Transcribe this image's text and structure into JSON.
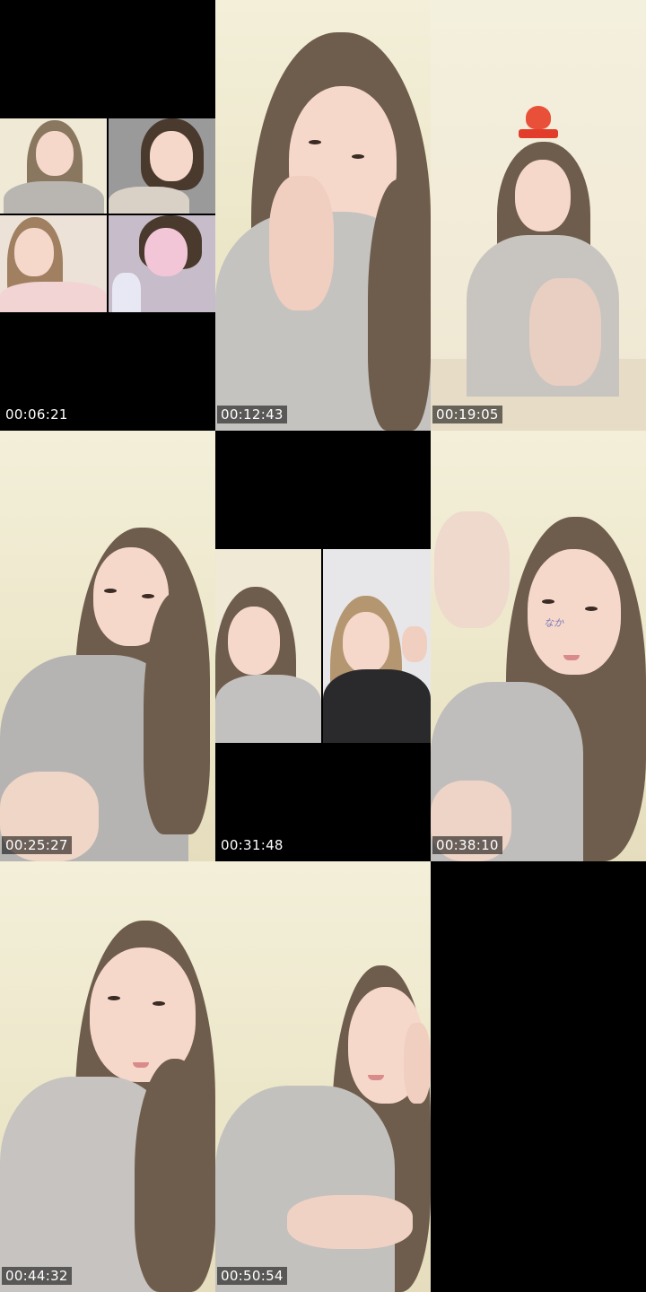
{
  "tiles": [
    {
      "timestamp": "00:06:21",
      "kind": "multi-call"
    },
    {
      "timestamp": "00:12:43",
      "kind": "selfie"
    },
    {
      "timestamp": "00:19:05",
      "kind": "sitting"
    },
    {
      "timestamp": "00:25:27",
      "kind": "crouch"
    },
    {
      "timestamp": "00:31:48",
      "kind": "duo-call"
    },
    {
      "timestamp": "00:38:10",
      "kind": "wave"
    },
    {
      "timestamp": "00:44:32",
      "kind": "selfie"
    },
    {
      "timestamp": "00:50:54",
      "kind": "selfie"
    },
    {
      "timestamp": "",
      "kind": "empty"
    }
  ],
  "colors": {
    "background": "#000000",
    "wall": "#f3efd9",
    "hair": "#6e5d4c",
    "shirt": "#b9b6b2",
    "badge": "#e9503a",
    "doodle": "#7a79b8"
  },
  "icons": {
    "badge": "heart-badge-icon"
  }
}
